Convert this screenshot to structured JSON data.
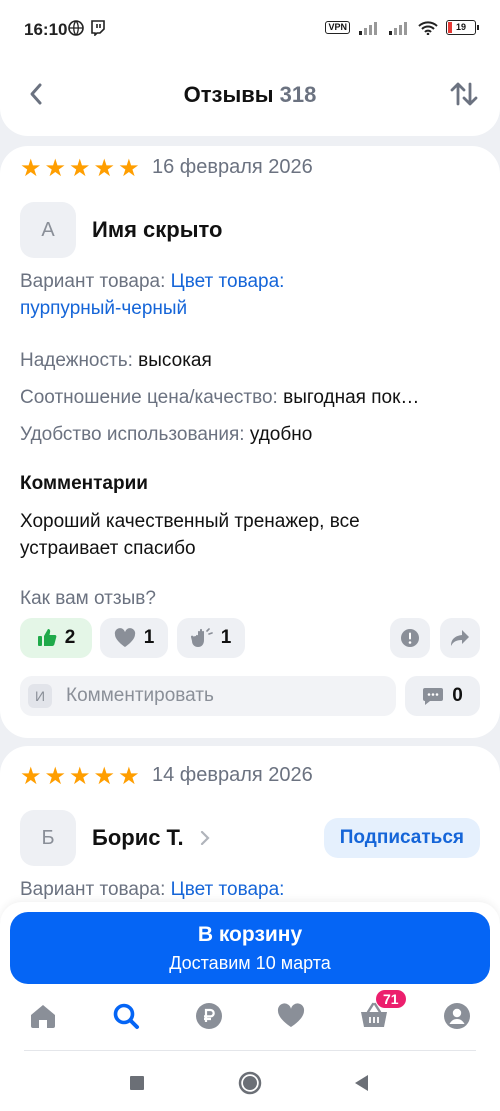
{
  "status_bar": {
    "time": "16:10",
    "vpn": "VPN",
    "battery": "19"
  },
  "header": {
    "title": "Отзывы",
    "count": "318",
    "back_icon": "chevron-left-icon",
    "sort_icon": "sort-arrows-icon"
  },
  "reviews": [
    {
      "stars": 5,
      "date": "16 февраля 2026",
      "avatar_letter": "А",
      "author": "Имя скрыто",
      "variant_label": "Вариант товара:",
      "variant_value_line1": "Цвет товара:",
      "variant_value_line2": "пурпурный-черный",
      "attributes": [
        {
          "label": "Надежность:",
          "value": "высокая"
        },
        {
          "label": "Соотношение цена/качество:",
          "value": "выгодная пок…"
        },
        {
          "label": "Удобство использования:",
          "value": "удобно"
        }
      ],
      "comment_heading": "Комментарии",
      "comment_line1": "Хороший качественный тренажер, все",
      "comment_line2": "устраивает спасибо",
      "reaction_prompt": "Как вам отзыв?",
      "reactions": {
        "likes": "2",
        "hearts": "1",
        "claps": "1"
      },
      "comment_input": {
        "avatar_letter": "И",
        "placeholder": "Комментировать",
        "comments_count": "0"
      }
    },
    {
      "stars": 5,
      "date": "14 февраля 2026",
      "avatar_letter": "Б",
      "author": "Борис Т.",
      "subscribe_label": "Подписаться",
      "variant_label": "Вариант товара:",
      "variant_value_line1": "Цвет товара:"
    }
  ],
  "cart_button": {
    "label": "В корзину",
    "sub_label": "Доставим 10 марта"
  },
  "tabbar": {
    "cart_badge": "71",
    "active_tab": "search"
  },
  "colors": {
    "accent": "#0565f5",
    "link": "#1565d8",
    "star": "#ff9e00",
    "badge": "#ec1f6d"
  }
}
